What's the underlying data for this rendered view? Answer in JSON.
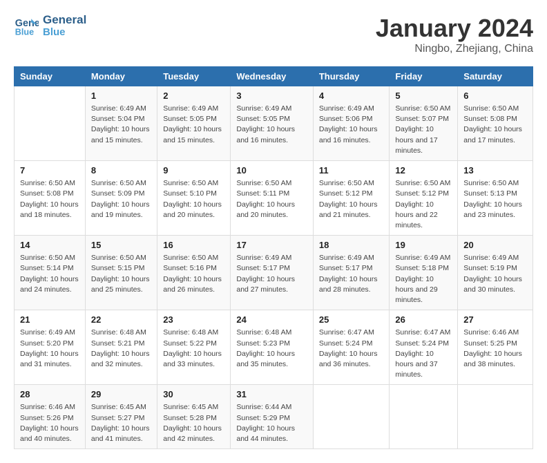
{
  "logo": {
    "line1": "General",
    "line2": "Blue"
  },
  "title": "January 2024",
  "subtitle": "Ningbo, Zhejiang, China",
  "days_of_week": [
    "Sunday",
    "Monday",
    "Tuesday",
    "Wednesday",
    "Thursday",
    "Friday",
    "Saturday"
  ],
  "weeks": [
    [
      {
        "day": "",
        "sunrise": "",
        "sunset": "",
        "daylight": ""
      },
      {
        "day": "1",
        "sunrise": "Sunrise: 6:49 AM",
        "sunset": "Sunset: 5:04 PM",
        "daylight": "Daylight: 10 hours and 15 minutes."
      },
      {
        "day": "2",
        "sunrise": "Sunrise: 6:49 AM",
        "sunset": "Sunset: 5:05 PM",
        "daylight": "Daylight: 10 hours and 15 minutes."
      },
      {
        "day": "3",
        "sunrise": "Sunrise: 6:49 AM",
        "sunset": "Sunset: 5:05 PM",
        "daylight": "Daylight: 10 hours and 16 minutes."
      },
      {
        "day": "4",
        "sunrise": "Sunrise: 6:49 AM",
        "sunset": "Sunset: 5:06 PM",
        "daylight": "Daylight: 10 hours and 16 minutes."
      },
      {
        "day": "5",
        "sunrise": "Sunrise: 6:50 AM",
        "sunset": "Sunset: 5:07 PM",
        "daylight": "Daylight: 10 hours and 17 minutes."
      },
      {
        "day": "6",
        "sunrise": "Sunrise: 6:50 AM",
        "sunset": "Sunset: 5:08 PM",
        "daylight": "Daylight: 10 hours and 17 minutes."
      }
    ],
    [
      {
        "day": "7",
        "sunrise": "Sunrise: 6:50 AM",
        "sunset": "Sunset: 5:08 PM",
        "daylight": "Daylight: 10 hours and 18 minutes."
      },
      {
        "day": "8",
        "sunrise": "Sunrise: 6:50 AM",
        "sunset": "Sunset: 5:09 PM",
        "daylight": "Daylight: 10 hours and 19 minutes."
      },
      {
        "day": "9",
        "sunrise": "Sunrise: 6:50 AM",
        "sunset": "Sunset: 5:10 PM",
        "daylight": "Daylight: 10 hours and 20 minutes."
      },
      {
        "day": "10",
        "sunrise": "Sunrise: 6:50 AM",
        "sunset": "Sunset: 5:11 PM",
        "daylight": "Daylight: 10 hours and 20 minutes."
      },
      {
        "day": "11",
        "sunrise": "Sunrise: 6:50 AM",
        "sunset": "Sunset: 5:12 PM",
        "daylight": "Daylight: 10 hours and 21 minutes."
      },
      {
        "day": "12",
        "sunrise": "Sunrise: 6:50 AM",
        "sunset": "Sunset: 5:12 PM",
        "daylight": "Daylight: 10 hours and 22 minutes."
      },
      {
        "day": "13",
        "sunrise": "Sunrise: 6:50 AM",
        "sunset": "Sunset: 5:13 PM",
        "daylight": "Daylight: 10 hours and 23 minutes."
      }
    ],
    [
      {
        "day": "14",
        "sunrise": "Sunrise: 6:50 AM",
        "sunset": "Sunset: 5:14 PM",
        "daylight": "Daylight: 10 hours and 24 minutes."
      },
      {
        "day": "15",
        "sunrise": "Sunrise: 6:50 AM",
        "sunset": "Sunset: 5:15 PM",
        "daylight": "Daylight: 10 hours and 25 minutes."
      },
      {
        "day": "16",
        "sunrise": "Sunrise: 6:50 AM",
        "sunset": "Sunset: 5:16 PM",
        "daylight": "Daylight: 10 hours and 26 minutes."
      },
      {
        "day": "17",
        "sunrise": "Sunrise: 6:49 AM",
        "sunset": "Sunset: 5:17 PM",
        "daylight": "Daylight: 10 hours and 27 minutes."
      },
      {
        "day": "18",
        "sunrise": "Sunrise: 6:49 AM",
        "sunset": "Sunset: 5:17 PM",
        "daylight": "Daylight: 10 hours and 28 minutes."
      },
      {
        "day": "19",
        "sunrise": "Sunrise: 6:49 AM",
        "sunset": "Sunset: 5:18 PM",
        "daylight": "Daylight: 10 hours and 29 minutes."
      },
      {
        "day": "20",
        "sunrise": "Sunrise: 6:49 AM",
        "sunset": "Sunset: 5:19 PM",
        "daylight": "Daylight: 10 hours and 30 minutes."
      }
    ],
    [
      {
        "day": "21",
        "sunrise": "Sunrise: 6:49 AM",
        "sunset": "Sunset: 5:20 PM",
        "daylight": "Daylight: 10 hours and 31 minutes."
      },
      {
        "day": "22",
        "sunrise": "Sunrise: 6:48 AM",
        "sunset": "Sunset: 5:21 PM",
        "daylight": "Daylight: 10 hours and 32 minutes."
      },
      {
        "day": "23",
        "sunrise": "Sunrise: 6:48 AM",
        "sunset": "Sunset: 5:22 PM",
        "daylight": "Daylight: 10 hours and 33 minutes."
      },
      {
        "day": "24",
        "sunrise": "Sunrise: 6:48 AM",
        "sunset": "Sunset: 5:23 PM",
        "daylight": "Daylight: 10 hours and 35 minutes."
      },
      {
        "day": "25",
        "sunrise": "Sunrise: 6:47 AM",
        "sunset": "Sunset: 5:24 PM",
        "daylight": "Daylight: 10 hours and 36 minutes."
      },
      {
        "day": "26",
        "sunrise": "Sunrise: 6:47 AM",
        "sunset": "Sunset: 5:24 PM",
        "daylight": "Daylight: 10 hours and 37 minutes."
      },
      {
        "day": "27",
        "sunrise": "Sunrise: 6:46 AM",
        "sunset": "Sunset: 5:25 PM",
        "daylight": "Daylight: 10 hours and 38 minutes."
      }
    ],
    [
      {
        "day": "28",
        "sunrise": "Sunrise: 6:46 AM",
        "sunset": "Sunset: 5:26 PM",
        "daylight": "Daylight: 10 hours and 40 minutes."
      },
      {
        "day": "29",
        "sunrise": "Sunrise: 6:45 AM",
        "sunset": "Sunset: 5:27 PM",
        "daylight": "Daylight: 10 hours and 41 minutes."
      },
      {
        "day": "30",
        "sunrise": "Sunrise: 6:45 AM",
        "sunset": "Sunset: 5:28 PM",
        "daylight": "Daylight: 10 hours and 42 minutes."
      },
      {
        "day": "31",
        "sunrise": "Sunrise: 6:44 AM",
        "sunset": "Sunset: 5:29 PM",
        "daylight": "Daylight: 10 hours and 44 minutes."
      },
      {
        "day": "",
        "sunrise": "",
        "sunset": "",
        "daylight": ""
      },
      {
        "day": "",
        "sunrise": "",
        "sunset": "",
        "daylight": ""
      },
      {
        "day": "",
        "sunrise": "",
        "sunset": "",
        "daylight": ""
      }
    ]
  ]
}
